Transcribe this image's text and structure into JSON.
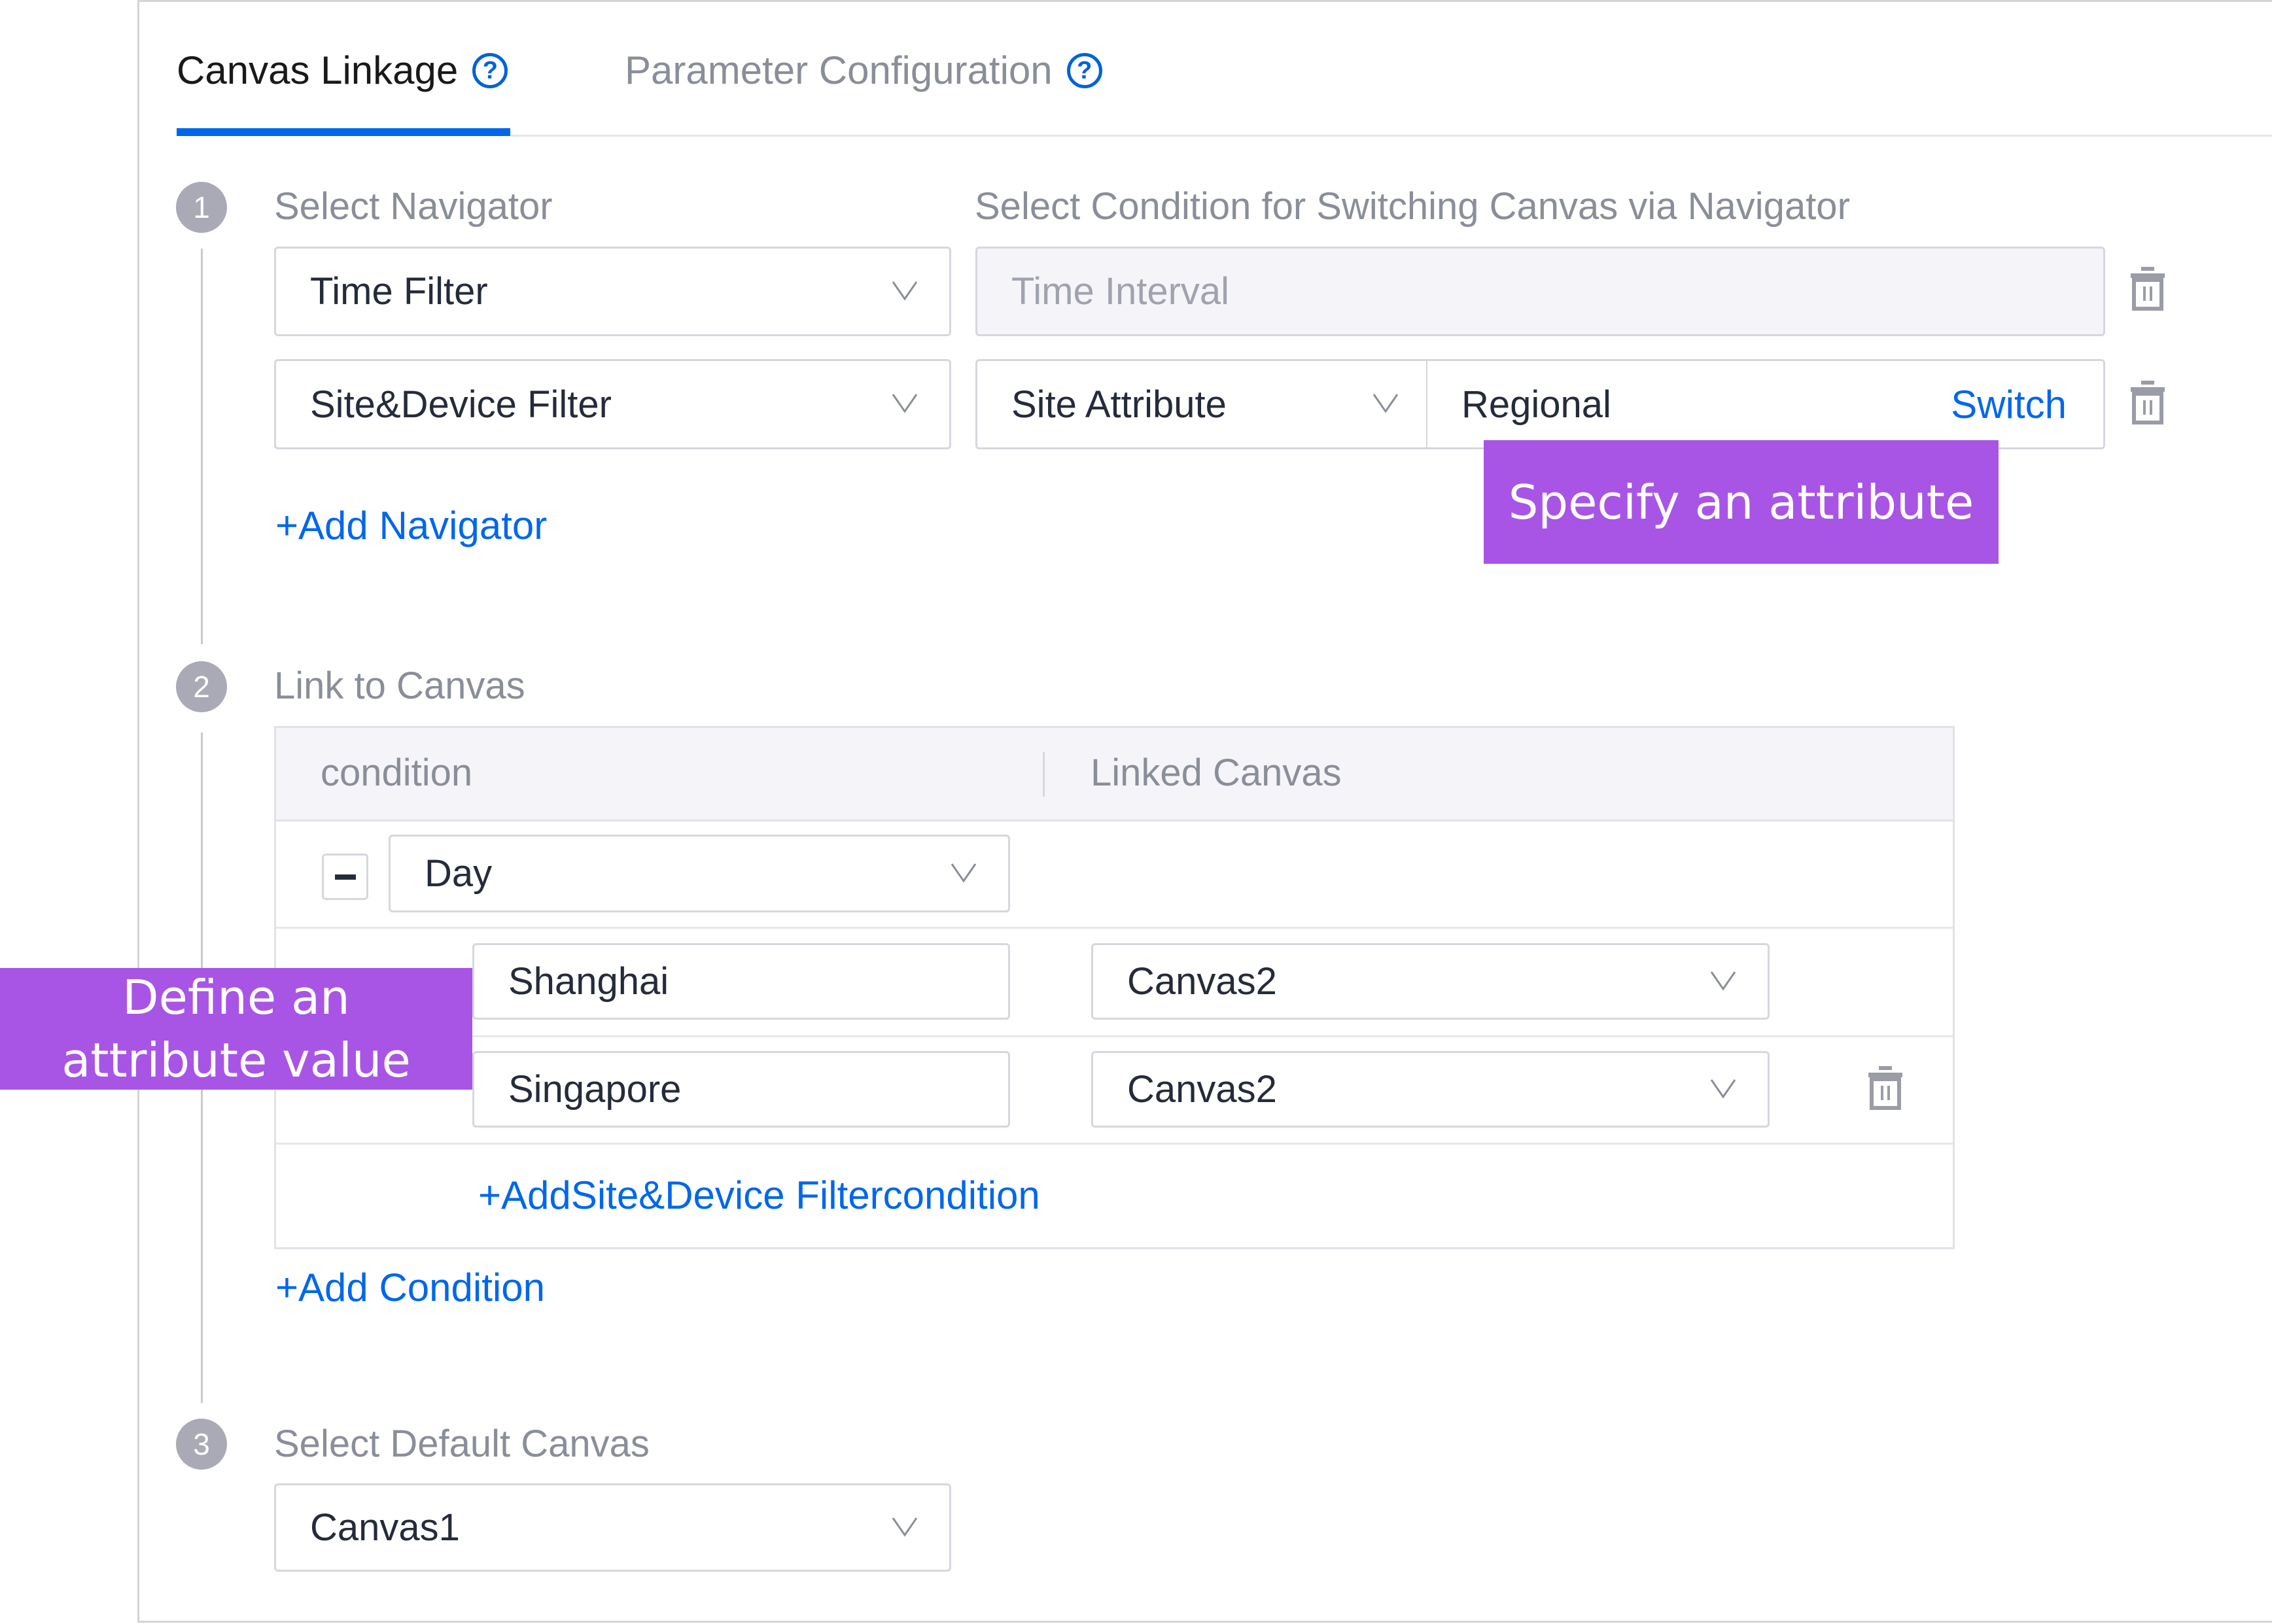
{
  "tabs": [
    {
      "label": "Canvas Linkage",
      "active": true,
      "icon": "help-circle-icon"
    },
    {
      "label": "Parameter Configuration",
      "active": false,
      "icon": "help-circle-icon"
    }
  ],
  "step1": {
    "number": "1",
    "label": "Select Navigator",
    "condition_label": "Select Condition for Switching Canvas via Navigator",
    "navigators": [
      {
        "value": "Time Filter",
        "condition": "Time Interval",
        "condition_disabled": true
      },
      {
        "value": "Site&Device Filter",
        "attribute_type": "Site Attribute",
        "attribute_value": "Regional",
        "switch_label": "Switch"
      }
    ],
    "add_navigator_label": "+Add Navigator"
  },
  "callouts": {
    "specify_attribute": "Specify an attribute",
    "define_value_line1": "Define an",
    "define_value_line2": "attribute value"
  },
  "step2": {
    "number": "2",
    "label": "Link to Canvas",
    "table": {
      "headers": [
        "condition",
        "Linked Canvas"
      ],
      "condition_value": "Day",
      "rows": [
        {
          "attribute_value": "Shanghai",
          "linked_canvas": "Canvas2"
        },
        {
          "attribute_value": "Singapore",
          "linked_canvas": "Canvas2"
        }
      ],
      "add_filter_condition_label": "+AddSite&Device Filtercondition"
    },
    "add_condition_label": "+Add Condition"
  },
  "step3": {
    "number": "3",
    "label": "Select Default Canvas",
    "default_canvas": "Canvas1"
  },
  "colors": {
    "accent": "#0067eb",
    "callout": "#a855e6",
    "step_circle": "#a9aab6"
  }
}
